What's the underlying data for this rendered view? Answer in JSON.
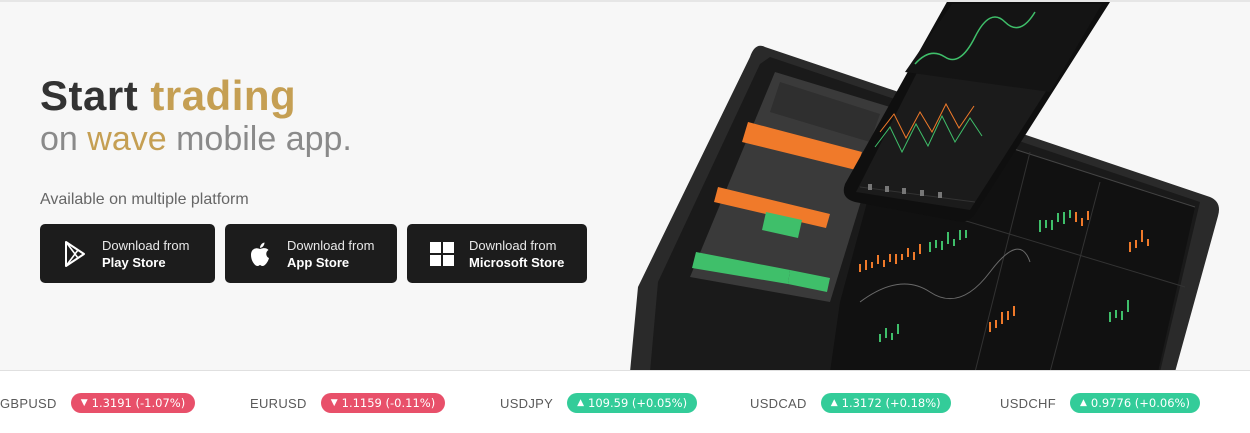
{
  "hero": {
    "title_part1": "Start ",
    "title_part2": "trading",
    "subtitle_part1": "on ",
    "subtitle_part2": "wave",
    "subtitle_part3": " mobile app.",
    "available_text": "Available on multiple platform",
    "buttons": [
      {
        "small": "Download from",
        "big": "Play Store",
        "icon": "play-store-icon"
      },
      {
        "small": "Download from",
        "big": "App Store",
        "icon": "apple-icon"
      },
      {
        "small": "Download from",
        "big": "Microsoft Store",
        "icon": "windows-icon"
      }
    ]
  },
  "colors": {
    "gold": "#c59f53",
    "down": "#e8506a",
    "up": "#33cc99",
    "button_bg": "#1c1c1c"
  },
  "ticker": [
    {
      "symbol": "GBPUSD",
      "change": "1.3191 (-1.07%)",
      "direction": "down"
    },
    {
      "symbol": "EURUSD",
      "change": "1.1159 (-0.11%)",
      "direction": "down"
    },
    {
      "symbol": "USDJPY",
      "change": "109.59 (+0.05%)",
      "direction": "up"
    },
    {
      "symbol": "USDCAD",
      "change": "1.3172 (+0.18%)",
      "direction": "up"
    },
    {
      "symbol": "USDCHF",
      "change": "0.9776 (+0.06%)",
      "direction": "up"
    }
  ]
}
